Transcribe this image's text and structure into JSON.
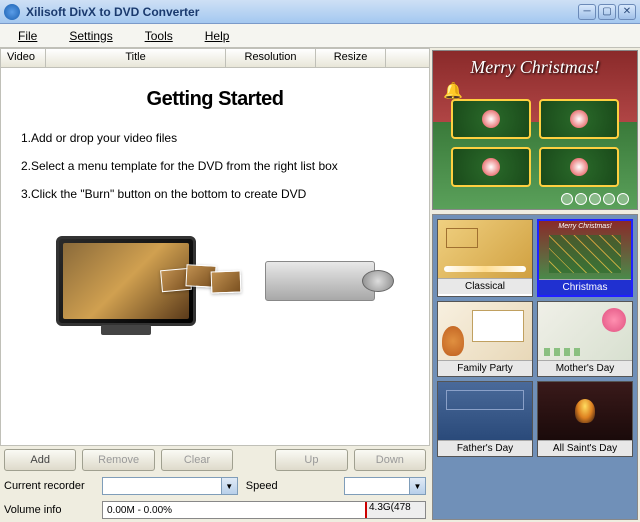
{
  "titlebar": {
    "title": "Xilisoft DivX to DVD Converter"
  },
  "menu": {
    "file": "File",
    "settings": "Settings",
    "tools": "Tools",
    "help": "Help"
  },
  "columns": {
    "video": "Video",
    "title": "Title",
    "resolution": "Resolution",
    "resize": "Resize"
  },
  "getting_started": {
    "heading": "Getting Started",
    "step1": "1.Add or drop your video files",
    "step2": "2.Select a menu template for the DVD from the right list box",
    "step3": "3.Click the \"Burn\" button on the bottom to create DVD"
  },
  "buttons": {
    "add": "Add",
    "remove": "Remove",
    "clear": "Clear",
    "up": "Up",
    "down": "Down"
  },
  "recorder": {
    "label": "Current recorder",
    "speed_label": "Speed"
  },
  "volume": {
    "label": "Volume info",
    "used": "0.00M - 0.00%",
    "marker": "4.3G(478"
  },
  "preview": {
    "banner": "Merry Christmas!"
  },
  "templates": [
    {
      "id": "classical",
      "label": "Classical"
    },
    {
      "id": "christmas",
      "label": "Christmas"
    },
    {
      "id": "family",
      "label": "Family Party"
    },
    {
      "id": "mothers",
      "label": "Mother's Day"
    },
    {
      "id": "fathers",
      "label": "Father's Day"
    },
    {
      "id": "saints",
      "label": "All Saint's Day"
    }
  ],
  "selected_template": "christmas"
}
